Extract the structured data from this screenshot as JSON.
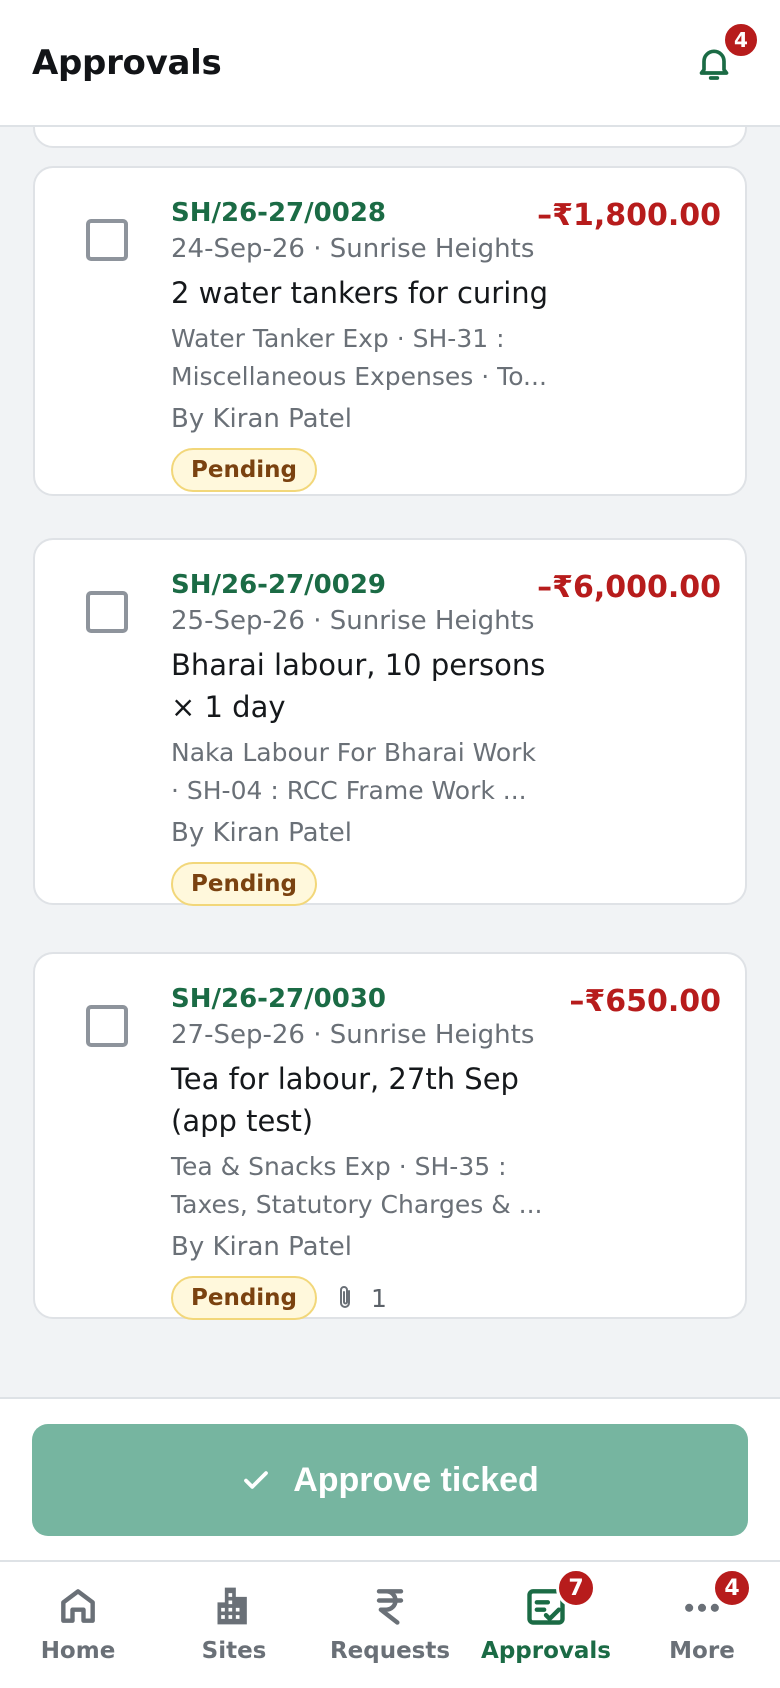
{
  "header": {
    "title": "Approvals",
    "notification_count": "4"
  },
  "approvals": [
    {
      "ref": "SH/26-27/0028",
      "meta": "24-Sep-26 · Sunrise Heights",
      "title": "2 water tankers for curing",
      "desc": "Water Tanker Exp · SH-31 : Miscellaneous Expenses · To...",
      "by": "By Kiran Patel",
      "status": "Pending",
      "amount": "–₹1,800.00"
    },
    {
      "ref": "SH/26-27/0029",
      "meta": "25-Sep-26 · Sunrise Heights",
      "title": "Bharai labour, 10 persons × 1 day",
      "desc": "Naka Labour For Bharai Work · SH-04 : RCC Frame Work ...",
      "by": "By Kiran Patel",
      "status": "Pending",
      "amount": "–₹6,000.00"
    },
    {
      "ref": "SH/26-27/0030",
      "meta": "27-Sep-26 · Sunrise Heights",
      "title": "Tea for labour, 27th Sep (app test)",
      "desc": "Tea & Snacks Exp · SH-35 : Taxes, Statutory Charges & ...",
      "by": "By Kiran Patel",
      "status": "Pending",
      "amount": "–₹650.00",
      "attachments": "1"
    }
  ],
  "action": {
    "approve_label": "Approve ticked"
  },
  "nav": {
    "items": [
      {
        "label": "Home",
        "icon": "home-icon"
      },
      {
        "label": "Sites",
        "icon": "building-icon"
      },
      {
        "label": "Requests",
        "icon": "rupee-icon"
      },
      {
        "label": "Approvals",
        "icon": "approvals-icon",
        "badge": "7",
        "active": true
      },
      {
        "label": "More",
        "icon": "more-icon",
        "badge": "4"
      }
    ]
  },
  "colors": {
    "brand_green": "#1b6b45",
    "amount_red": "#b71c1c",
    "button_green": "#76b5a0",
    "pending_bg": "#fff8dc"
  }
}
